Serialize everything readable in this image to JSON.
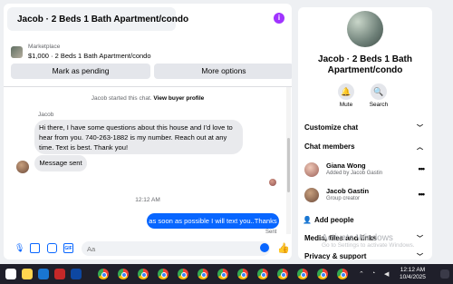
{
  "chat": {
    "title": "Jacob · 2 Beds 1 Bath Apartment/condo",
    "info_icon": "info-icon",
    "marketplace_label": "Marketplace",
    "listing": "$1,000 · 2 Beds 1 Bath Apartment/condo",
    "mark_pending_label": "Mark as pending",
    "more_options_label": "More options",
    "started_text": "Jacob started this chat.",
    "view_profile_label": "View buyer profile",
    "sender_name": "Jacob",
    "incoming_message": "Hi there, I have some questions about this house and I'd love to hear from you. 740-263-1882 is my number. Reach out at any time. Text is best. Thank you!",
    "auto_reply": "Message sent",
    "timestamp": "12:12 AM",
    "outgoing_message": "as soon as possible I will text you..Thanks",
    "status": "Sent",
    "input_placeholder": "Aa",
    "accent_color": "#0866ff"
  },
  "info": {
    "title": "Jacob · 2 Beds 1 Bath Apartment/condo",
    "mute_label": "Mute",
    "search_label": "Search",
    "customize_label": "Customize chat",
    "members_label": "Chat members",
    "members": [
      {
        "name": "Giana Wong",
        "sub": "Added by Jacob Gastin"
      },
      {
        "name": "Jacob Gastin",
        "sub": "Group creator"
      }
    ],
    "add_people_label": "Add people",
    "media_label": "Media, files and links",
    "privacy_label": "Privacy & support"
  },
  "watermark": {
    "title": "Activate Windows",
    "subtitle": "Go to Settings to activate Windows."
  },
  "taskbar": {
    "time": "12:12 AM",
    "date": "10/4/2025"
  }
}
